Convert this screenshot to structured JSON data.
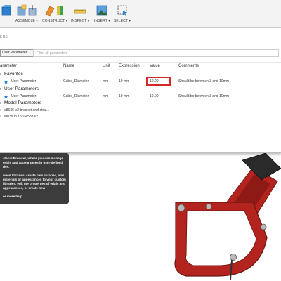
{
  "toolbar": {
    "groups": [
      {
        "label": "",
        "icons": [
          "solid-box-icon",
          "solid-sphere-icon"
        ]
      },
      {
        "label": "ASSEMBLE ▾",
        "icons": [
          "new-component-icon",
          "joint-icon"
        ]
      },
      {
        "label": "CONSTRUCT ▾",
        "icons": [
          "offset-plane-icon",
          "midplane-icon"
        ]
      },
      {
        "label": "INSPECT ▾",
        "icons": [
          "measure-icon"
        ]
      },
      {
        "label": "INSERT ▾",
        "icons": [
          "insert-image-icon"
        ]
      },
      {
        "label": "SELECT ▾",
        "icons": [
          "select-icon"
        ]
      }
    ],
    "colors": {
      "accent_blue": "#2d7fd0",
      "accent_orange": "#e98c2a",
      "accent_green": "#3aa54a"
    }
  },
  "dialog": {
    "title": "ERS",
    "tab_label": "User Parameter",
    "filter_placeholder": "Filter all parameters",
    "columns": [
      "arameter",
      "Name",
      "Unit",
      "Expression",
      "Value",
      "Comments"
    ],
    "groups": {
      "favorites": "Favorites",
      "user_parameters": "User Parameters",
      "model_parameters": "Model Parameters"
    },
    "favorites_rows": [
      {
        "type": "User Parameter",
        "name": "Cable_Diameter",
        "unit": "mm",
        "expression": "10 mm",
        "value": "10.00",
        "comment": "Should be between 3 and 10mm"
      }
    ],
    "user_rows": [
      {
        "type": "User Parameter",
        "name": "Cable_Diameter",
        "unit": "mm",
        "expression": "10 mm",
        "value": "10.00",
        "comment": "Should be between 3 and 10mm"
      }
    ],
    "model_items": [
      "e8636-v2-bracket-and-strai...",
      "M03x08.15014583 v2"
    ],
    "highlight_color": "#d62828"
  },
  "tooltip": {
    "paragraphs": [
      "aterial Browser, where you can manage erials and appearances in user-defined ries.",
      "ween libraries, create new libraries, and materials or appearances to your custom libraries, edit the properties of erials and appearances, or create new",
      "or more help."
    ]
  },
  "model": {
    "body_color": "#b3241f",
    "part_color": "#2a2a2a",
    "screw_color": "#b9b9b9"
  }
}
